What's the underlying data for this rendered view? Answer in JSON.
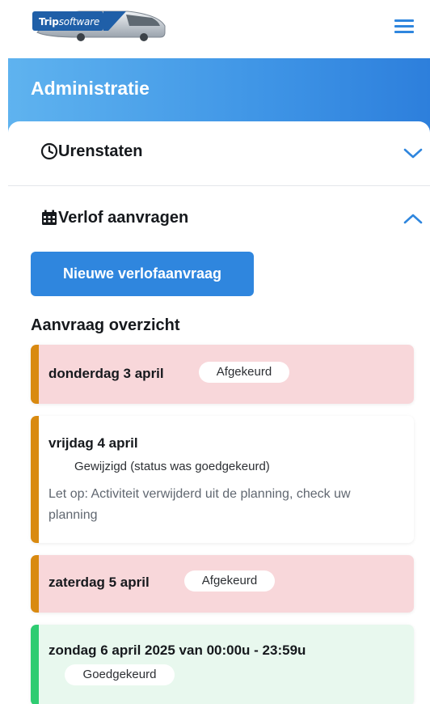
{
  "header": {
    "logo_text_bold": "Trip",
    "logo_text_soft": "software"
  },
  "admin": {
    "title": "Administratie"
  },
  "sections": {
    "urenstaten": {
      "label": "Urenstaten",
      "expanded": false
    },
    "verlof": {
      "label": "Verlof aanvragen",
      "expanded": true
    }
  },
  "verlof": {
    "new_button": "Nieuwe verlofaanvraag",
    "overview_title": "Aanvraag overzicht",
    "requests": [
      {
        "date": "donderdag 3 april",
        "status": "Afgekeurd",
        "status_color": "#f8d7da",
        "accent": "#d98a10"
      },
      {
        "date": "vrijdag 4 april",
        "status": "Gewijzigd (status was goedgekeurd)",
        "note": "Let op: Activiteit verwijderd uit de planning, check uw planning",
        "status_color": "#ffffff",
        "accent": "#d98a10"
      },
      {
        "date": "zaterdag 5 april",
        "status": "Afgekeurd",
        "status_color": "#f8d7da",
        "accent": "#d98a10"
      },
      {
        "date": "zondag 6 april 2025 van 00:00u - 23:59u",
        "status": "Goedgekeurd",
        "status_color": "#e8f8ee",
        "accent": "#2ecc71"
      }
    ]
  },
  "colors": {
    "brand_blue": "#2f86de",
    "header_gradient_start": "#5fb3ef",
    "header_gradient_end": "#2d7fdc",
    "rejected_bg": "#f8d7da",
    "approved_bg": "#e8f8ee",
    "warning_accent": "#d98a10",
    "approved_accent": "#2ecc71"
  }
}
